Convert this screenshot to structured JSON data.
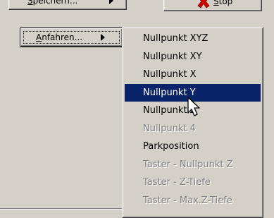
{
  "buttons": {
    "save": {
      "label": "Speichern...",
      "mnemonic_index": 0
    },
    "stop": {
      "label": "Stop"
    },
    "approach": {
      "label": "Anfahren..."
    }
  },
  "submenu": {
    "items": [
      {
        "label": "Nullpunkt XYZ",
        "state": "enabled"
      },
      {
        "label": "Nullpunkt XY",
        "state": "enabled"
      },
      {
        "label": "Nullpunkt X",
        "state": "enabled"
      },
      {
        "label": "Nullpunkt Y",
        "state": "selected"
      },
      {
        "label": "Nullpunkt Z",
        "state": "enabled"
      },
      {
        "label": "Nullpunkt 4",
        "state": "disabled"
      },
      {
        "label": "Parkposition",
        "state": "enabled"
      },
      {
        "label": "Taster - Nullpunkt Z",
        "state": "disabled"
      },
      {
        "label": "Taster - Z-Tiefe",
        "state": "disabled"
      },
      {
        "label": "Taster - Max.Z-Tiefe",
        "state": "disabled"
      }
    ]
  },
  "icons": {
    "stop": "red-x-icon",
    "submenu_arrow": "triangle-right-icon",
    "cursor": "mouse-pointer-icon"
  },
  "colors": {
    "face": "#d4d0c8",
    "highlight": "#0a246a",
    "disabled_text": "#808080",
    "stop_red": "#d40000"
  }
}
